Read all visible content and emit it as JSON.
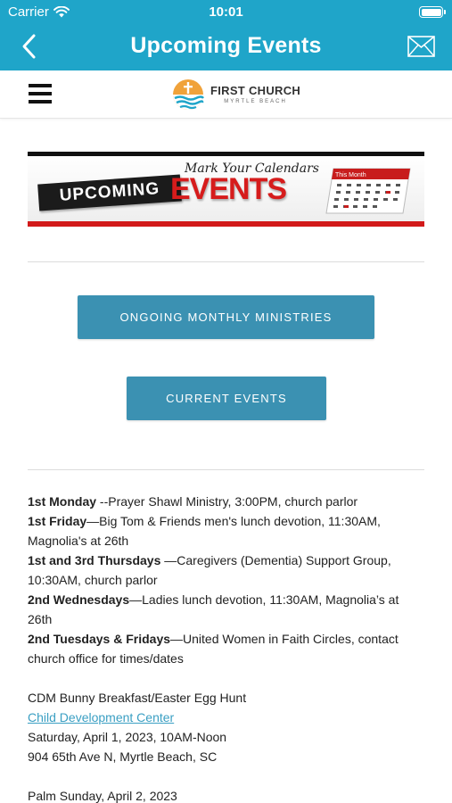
{
  "status": {
    "carrier": "Carrier",
    "time": "10:01"
  },
  "nav": {
    "title": "Upcoming Events"
  },
  "site": {
    "logo_name": "FIRST CHURCH",
    "logo_sub": "MYRTLE BEACH"
  },
  "banner": {
    "badge": "UPCOMING",
    "tagline": "Mark Your Calendars",
    "events": "EVENTS",
    "calendar_label": "This Month"
  },
  "buttons": {
    "ongoing": "ONGOING MONTHLY MINISTRIES",
    "current": "CURRENT EVENTS"
  },
  "ministries": [
    {
      "day": "1st Monday",
      "text": " --Prayer Shawl Ministry, 3:00PM, church parlor"
    },
    {
      "day": "1st Friday",
      "text": "—Big Tom & Friends men's lunch devotion, 11:30AM, Magnolia's at 26th"
    },
    {
      "day": "1st and 3rd Thursdays",
      "text": " —Caregivers (Dementia) Support Group, 10:30AM, church parlor"
    },
    {
      "day": "2nd Wednesdays",
      "text": "—Ladies lunch devotion, 11:30AM, Magnolia’s at 26th"
    },
    {
      "day": "2nd Tuesdays & Fridays",
      "text": "—United Women in Faith Circles, contact church office for times/dates"
    }
  ],
  "event": {
    "title": "CDM Bunny Breakfast/Easter Egg Hunt",
    "link": "Child Development Center",
    "date": "Saturday, April 1, 2023, 10AM-Noon",
    "address": "904 65th Ave N, Myrtle Beach, SC"
  },
  "next_event": {
    "title": "Palm Sunday, April 2, 2023"
  },
  "colors": {
    "nav_bg": "#1fa5c9",
    "button_bg": "#3b91b2",
    "link": "#3a9fc3",
    "banner_red": "#d21a1a"
  },
  "icons": {
    "back": "chevron-left-icon",
    "mail": "envelope-icon",
    "menu": "hamburger-menu-icon",
    "wifi": "wifi-icon",
    "battery": "battery-icon"
  }
}
